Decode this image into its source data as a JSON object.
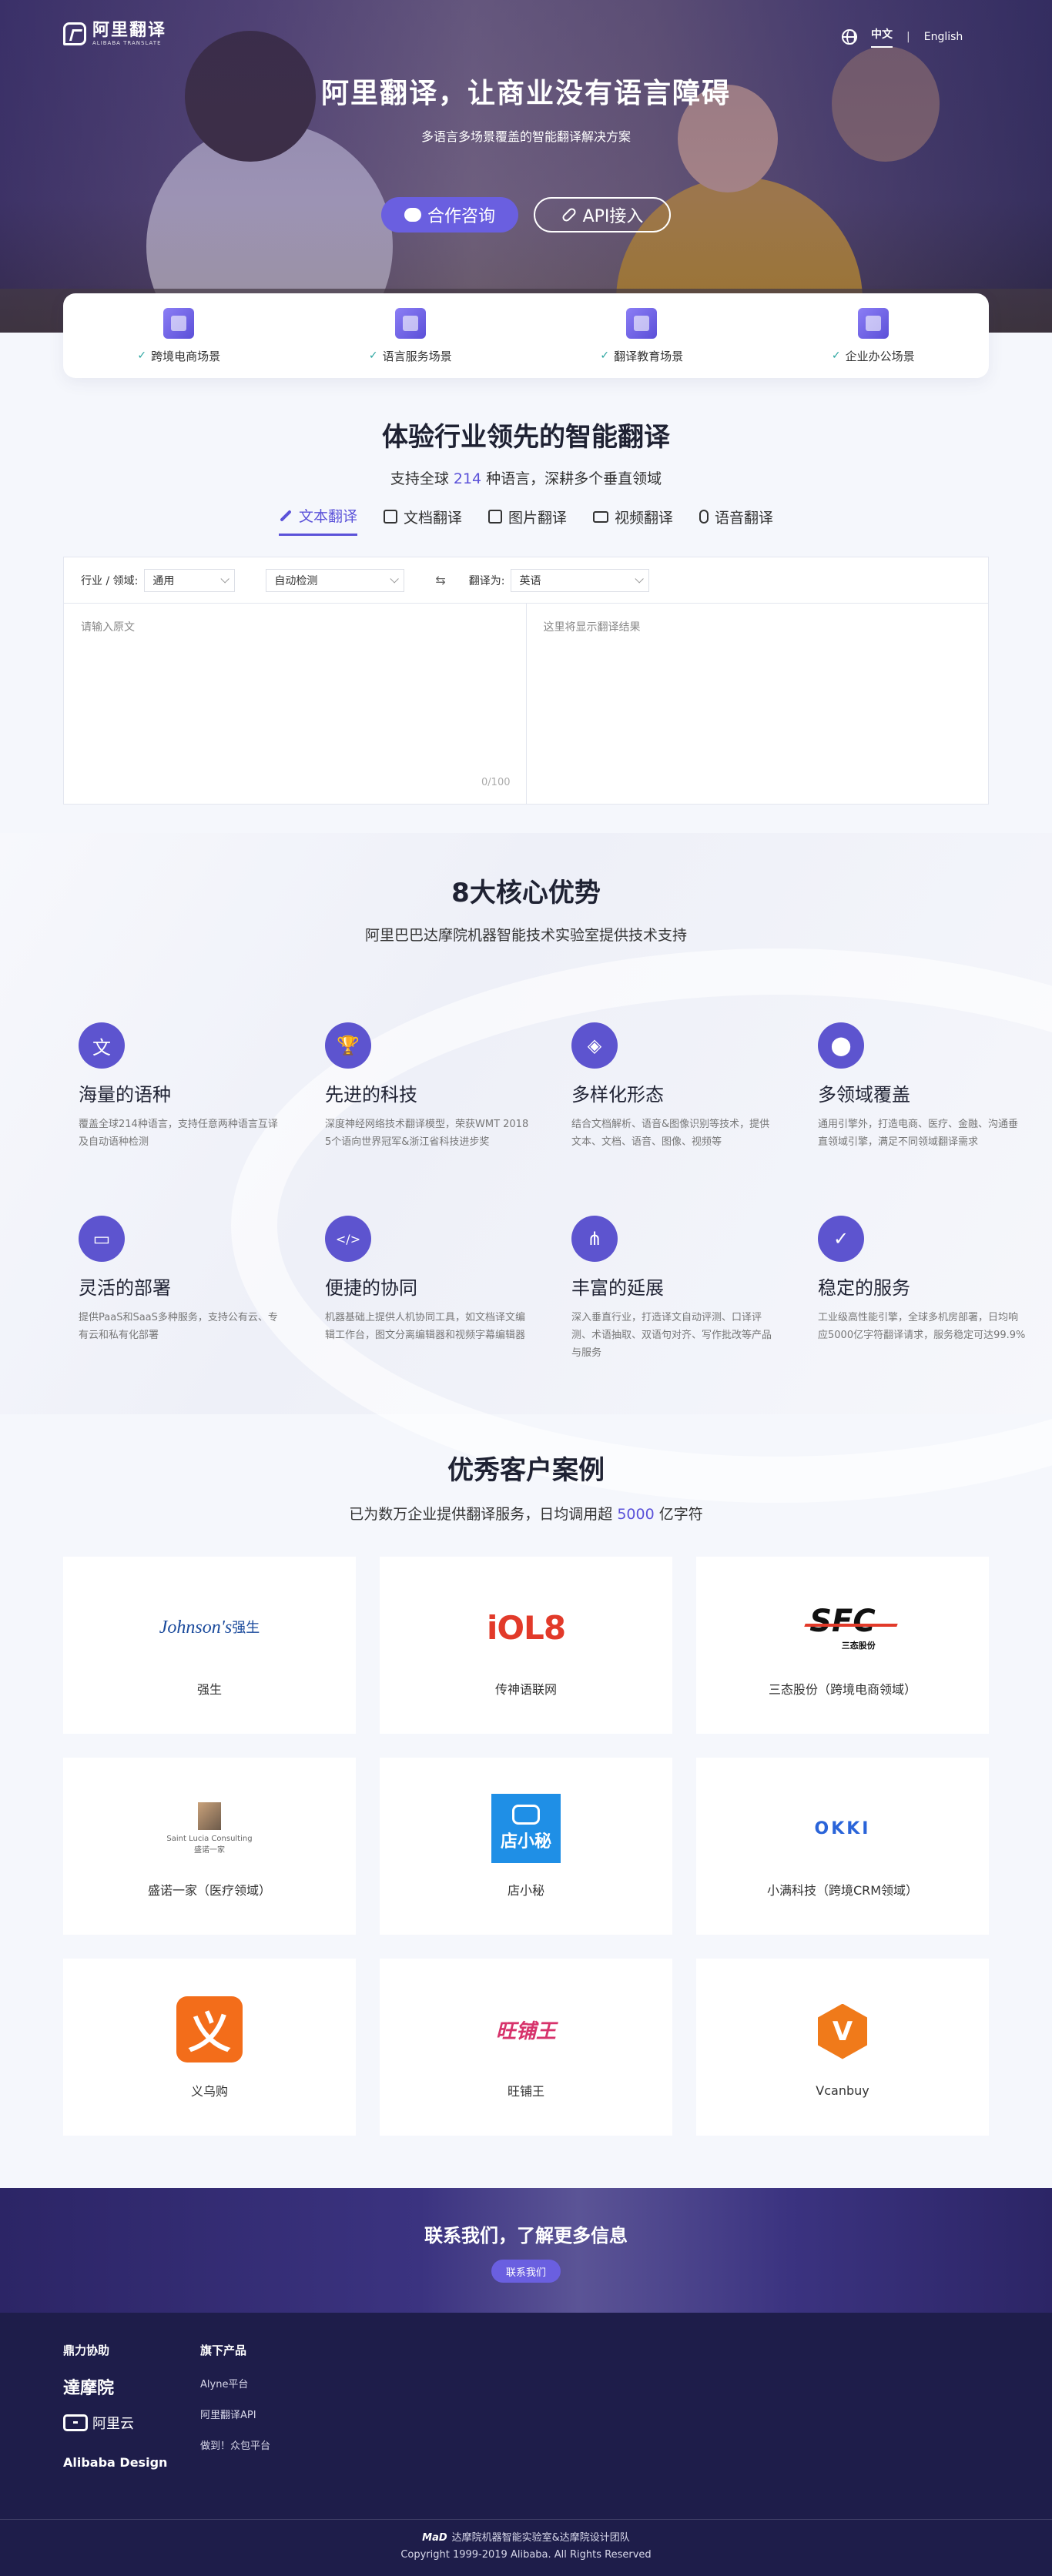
{
  "header": {
    "logo_cn": "阿里翻译",
    "logo_en": "ALIBABA TRANSLATE",
    "lang_active": "中文",
    "lang_sep": "|",
    "lang_other": "English"
  },
  "hero": {
    "title": "阿里翻译，让商业没有语言障碍",
    "subtitle": "多语言多场景覆盖的智能翻译解决方案",
    "btn_consult": "合作咨询",
    "btn_api": "API接入"
  },
  "scenes": [
    {
      "label": "跨境电商场景",
      "icon": "shopping-bag-icon"
    },
    {
      "label": "语言服务场景",
      "icon": "language-icon"
    },
    {
      "label": "翻译教育场景",
      "icon": "graduation-cap-icon"
    },
    {
      "label": "企业办公场景",
      "icon": "office-building-icon"
    }
  ],
  "translate": {
    "title": "体验行业领先的智能翻译",
    "subtitle_pre": "支持全球 ",
    "subtitle_num": "214",
    "subtitle_post": " 种语言，深耕多个垂直领域",
    "tabs": [
      {
        "label": "文本翻译",
        "icon": "pen-icon"
      },
      {
        "label": "文档翻译",
        "icon": "document-icon"
      },
      {
        "label": "图片翻译",
        "icon": "image-icon"
      },
      {
        "label": "视频翻译",
        "icon": "video-icon"
      },
      {
        "label": "语音翻译",
        "icon": "microphone-icon"
      }
    ],
    "domain_label": "行业 / 领域:",
    "domain_value": "通用",
    "source_value": "自动检测",
    "swap": "⇆",
    "target_label": "翻译为:",
    "target_value": "英语",
    "input_placeholder": "请输入原文",
    "output_placeholder": "这里将显示翻译结果",
    "counter": "0/100"
  },
  "advantages": {
    "title": "8大核心优势",
    "subtitle": "阿里巴巴达摩院机器智能技术实验室提供技术支持",
    "items": [
      {
        "title": "海量的语种",
        "desc": "覆盖全球214种语言，支持任意两种语言互译及自动语种检测",
        "icon": "translate-icon",
        "glyph": "文"
      },
      {
        "title": "先进的科技",
        "desc": "深度神经网络技术翻译模型，荣获WMT 2018 5个语向世界冠军&浙江省科技进步奖",
        "icon": "trophy-icon",
        "glyph": "🏆"
      },
      {
        "title": "多样化形态",
        "desc": "结合文档解析、语音&图像识别等技术，提供文本、文档、语音、图像、视频等",
        "icon": "layers-icon",
        "glyph": "◈"
      },
      {
        "title": "多领域覆盖",
        "desc": "通用引擎外，打造电商、医疗、金融、沟通垂直领域引擎，满足不同领域翻译需求",
        "icon": "bubbles-icon",
        "glyph": "⬤"
      },
      {
        "title": "灵活的部署",
        "desc": "提供PaaS和SaaS多种服务，支持公有云、专有云和私有化部署",
        "icon": "monitor-icon",
        "glyph": "▭"
      },
      {
        "title": "便捷的协同",
        "desc": "机器基础上提供人机协同工具，如文档译文编辑工作台，图文分离编辑器和视频字幕编辑器",
        "icon": "code-window-icon",
        "glyph": "</>"
      },
      {
        "title": "丰富的延展",
        "desc": "深入垂直行业，打造译文自动评测、口译评测、术语抽取、双语句对齐、写作批改等产品与服务",
        "icon": "share-icon",
        "glyph": "⋔"
      },
      {
        "title": "稳定的服务",
        "desc": "工业级高性能引擎，全球多机房部署，日均响应5000亿字符翻译请求，服务稳定可达99.9%",
        "icon": "shield-check-icon",
        "glyph": "✓"
      }
    ]
  },
  "customers": {
    "title": "优秀客户案例",
    "subtitle_pre": "已为数万企业提供翻译服务，日均调用超 ",
    "subtitle_num": "5000",
    "subtitle_post": " 亿字符",
    "items": [
      {
        "name": "强生",
        "logo_text": "Johnson's",
        "logo_sub": "强生"
      },
      {
        "name": "传神语联网",
        "logo_text": "iOL8"
      },
      {
        "name": "三态股份（跨境电商领域）",
        "logo_text": "SFC",
        "logo_sub": "三态股份"
      },
      {
        "name": "盛诺一家（医疗领域）",
        "logo_text": "Saint Lucia Consulting",
        "logo_sub": "盛诺一家"
      },
      {
        "name": "店小秘",
        "logo_text": "店小秘"
      },
      {
        "name": "小满科技（跨境CRM领域）",
        "logo_text": "OKKI"
      },
      {
        "name": "义乌购",
        "logo_text": "义"
      },
      {
        "name": "旺铺王",
        "logo_text": "旺铺王"
      },
      {
        "name": "Vcanbuy",
        "logo_text": "V"
      }
    ]
  },
  "contact": {
    "title": "联系我们，了解更多信息",
    "button": "联系我们"
  },
  "footer": {
    "col1_title": "鼎力协助",
    "partner_damo": "達摩院",
    "partner_aliyun": "阿里云",
    "partner_design": "Alibaba Design",
    "col2_title": "旗下产品",
    "links": [
      "Alyne平台",
      "阿里翻译API",
      "做到！众包平台"
    ],
    "mad_logo": "MaD",
    "team": "达摩院机器智能实验室&达摩院设计团队",
    "copyright": "Copyright 1999-2019 Alibaba. All Rights Reserved"
  },
  "colors": {
    "accent": "#5b52d9",
    "button": "#6a5fe0",
    "footer_bg": "#1e1d4a"
  }
}
